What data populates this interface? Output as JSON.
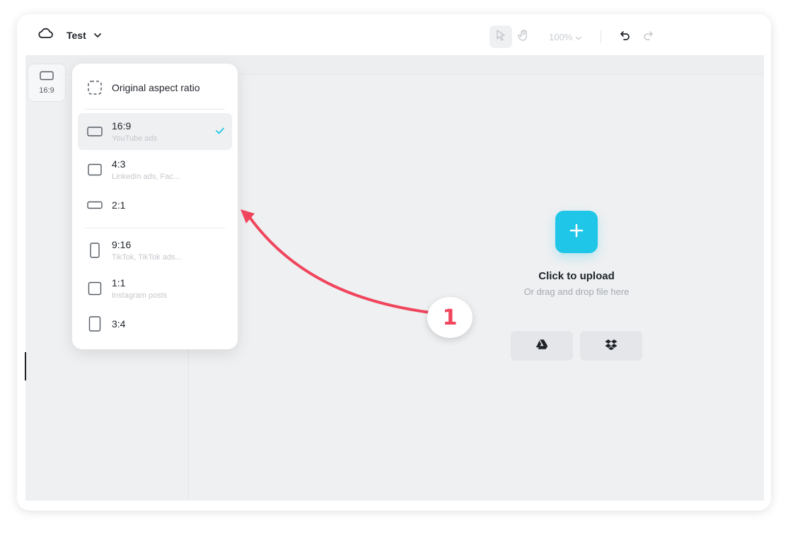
{
  "project": {
    "name": "Test"
  },
  "toolbar": {
    "zoom": "100%"
  },
  "ratio_button": {
    "label": "16:9"
  },
  "ratio_menu": {
    "original": "Original aspect ratio",
    "items": [
      {
        "label": "16:9",
        "sub": "YouTube ads",
        "selected": true
      },
      {
        "label": "4:3",
        "sub": "LinkedIn ads, Fac..."
      },
      {
        "label": "2:1",
        "sub": ""
      },
      {
        "label": "9:16",
        "sub": "TikTok, TikTok ads..."
      },
      {
        "label": "1:1",
        "sub": "Instagram posts"
      },
      {
        "label": "3:4",
        "sub": ""
      }
    ]
  },
  "upload": {
    "title": "Click to upload",
    "subtitle": "Or drag and drop file here"
  },
  "annotation": {
    "step": "1"
  },
  "colors": {
    "accent": "#1fc6e8",
    "annotation": "#f0455c",
    "workspace": "#eef0f2"
  },
  "icons": {
    "project": "cloud-icon",
    "select_tool": "cursor-icon",
    "pan_tool": "hand-icon",
    "undo": "undo-icon",
    "redo": "redo-icon",
    "drive": "google-drive-icon",
    "dropbox": "dropbox-icon"
  }
}
